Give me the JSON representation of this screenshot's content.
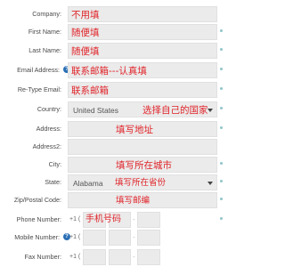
{
  "form": {
    "company": {
      "label": "Company:",
      "hint": "不用填"
    },
    "first_name": {
      "label": "First Name:",
      "hint": "随便填"
    },
    "last_name": {
      "label": "Last Name:",
      "hint": "随便填"
    },
    "email": {
      "label": "Email Address:",
      "hint": "联系邮箱---认真填",
      "help_icon": "?"
    },
    "retype_email": {
      "label": "Re-Type Email:",
      "hint": "联系邮箱"
    },
    "country": {
      "label": "Country:",
      "value": "United States",
      "hint": "选择自己的国家"
    },
    "address": {
      "label": "Address:",
      "hint": "填写地址"
    },
    "address2": {
      "label": "Address2:"
    },
    "city": {
      "label": "City:",
      "hint": "填写所在城市"
    },
    "state": {
      "label": "State:",
      "value": "Alabama",
      "hint": "填写所在省份"
    },
    "zip": {
      "label": "Zip/Postal Code:",
      "hint": "填写邮编"
    },
    "phone": {
      "label": "Phone Number:",
      "prefix": "+1 (",
      "hint": "手机号码",
      "sep": "-"
    },
    "mobile": {
      "label": "Mobile Number:",
      "prefix": "+1 (",
      "help_icon": "?",
      "sep": "-"
    },
    "fax": {
      "label": "Fax Number:",
      "prefix": "+1 (",
      "sep": "-"
    }
  },
  "colors": {
    "hint": "#e0242a",
    "field_bg": "#ebebeb",
    "required_dot": "#8ec5c9",
    "help_icon": "#2a6fb5"
  }
}
